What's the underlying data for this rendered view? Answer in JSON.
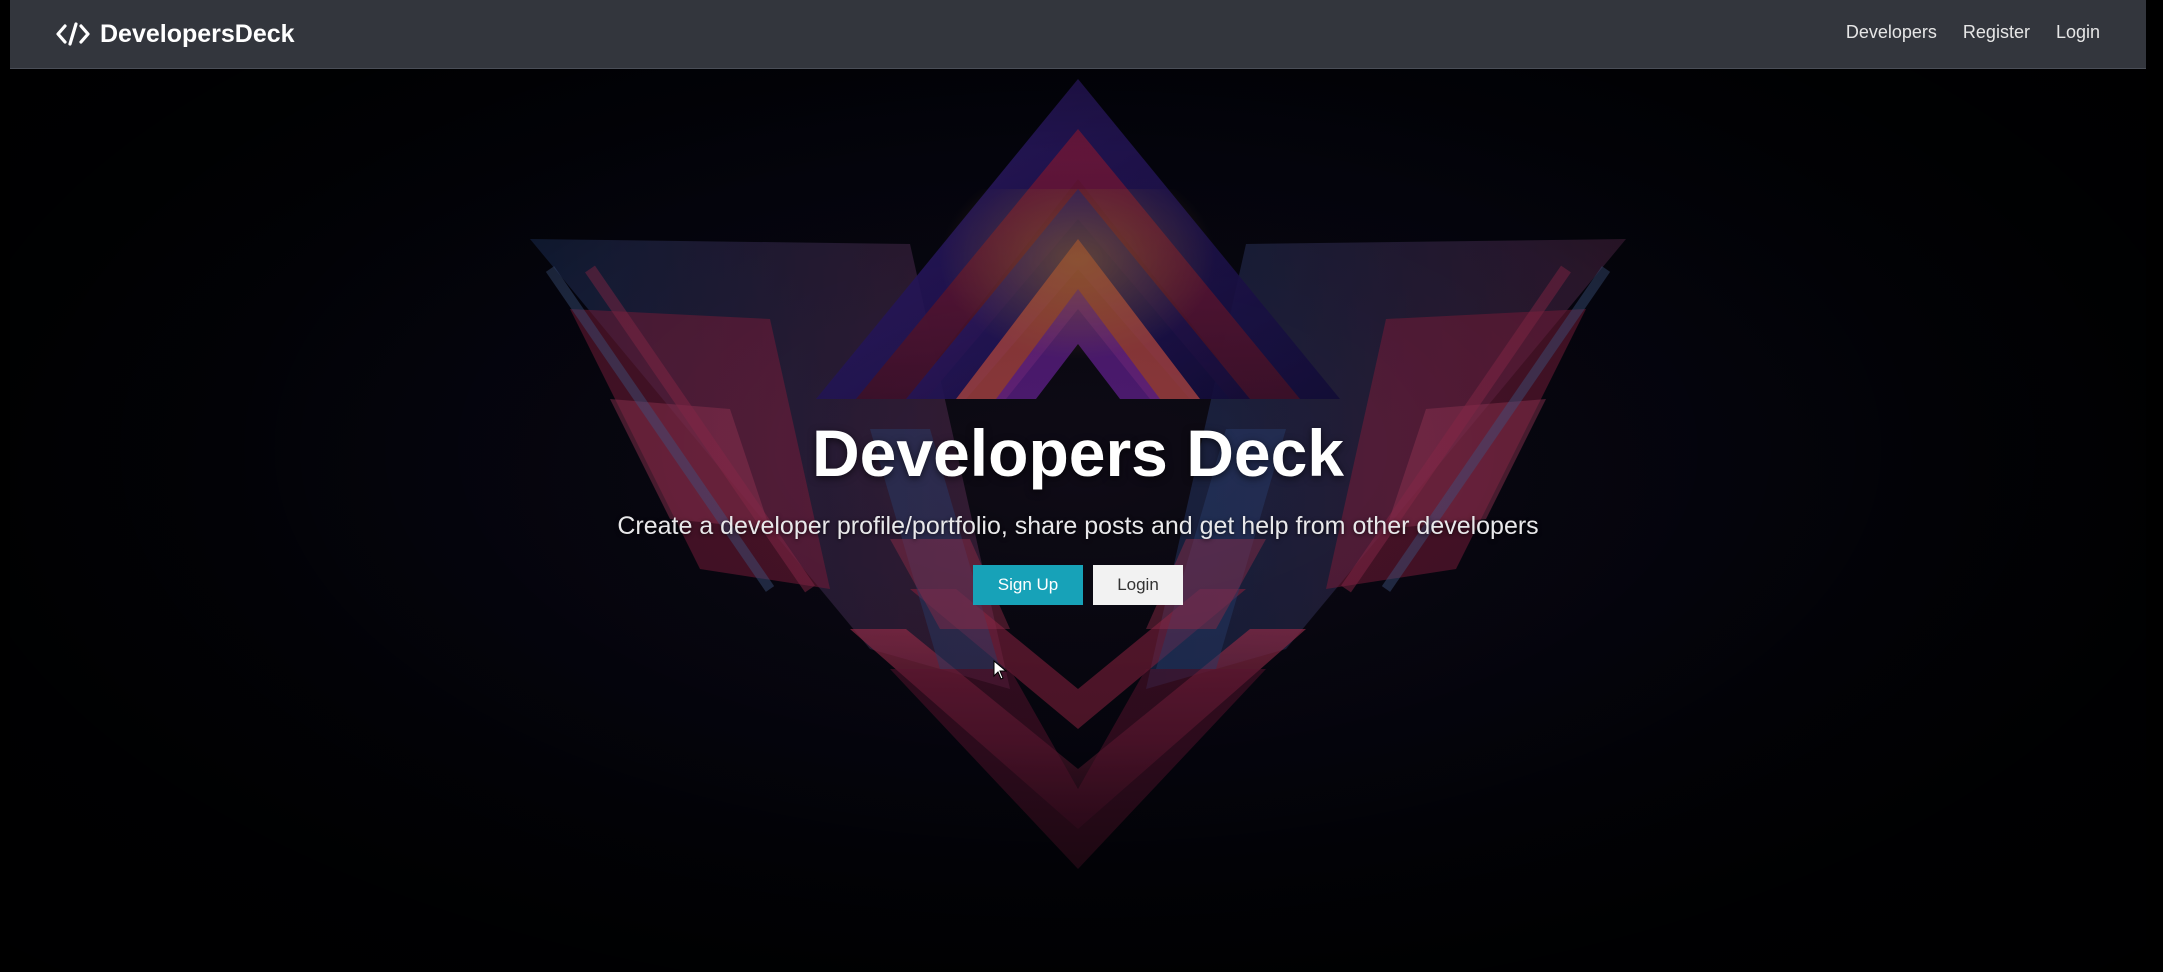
{
  "navbar": {
    "brand": "DevelopersDeck",
    "links": [
      "Developers",
      "Register",
      "Login"
    ]
  },
  "hero": {
    "title": "Developers Deck",
    "lead": "Create a developer profile/portfolio, share posts and get help from other developers",
    "primary_button": "Sign Up",
    "secondary_button": "Login"
  },
  "icons": {
    "brand": "code-icon",
    "pointer": "mouse-pointer-icon"
  },
  "colors": {
    "navbar_bg": "#33363d",
    "primary_button": "#17a2b8",
    "secondary_button": "#f2f2f2",
    "background": "#03040d"
  }
}
